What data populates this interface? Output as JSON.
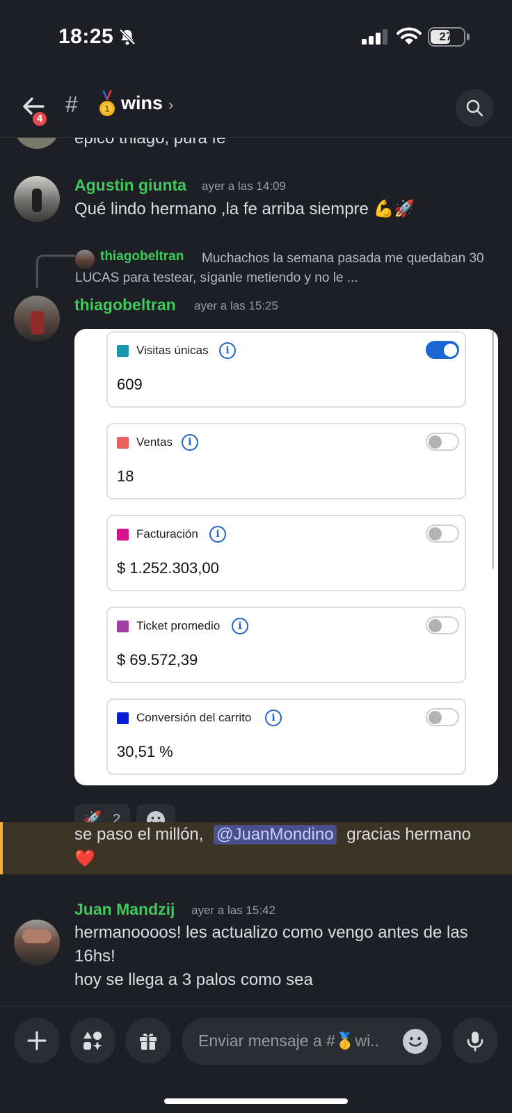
{
  "status_bar": {
    "time": "18:25",
    "battery": "27"
  },
  "header": {
    "back_badge": "4",
    "hash": "#",
    "channel_name": "wins",
    "chevron": "›"
  },
  "messages": [
    {
      "text": "epico thiago, pura fe"
    },
    {
      "username": "Agustin giunta",
      "timestamp": "ayer a las 14:09",
      "text": "Qué lindo hermano ,la fe arriba siempre 💪🚀"
    },
    {
      "reply": {
        "username": "thiagobeltran",
        "text": "Muchachos la semana pasada me quedaban 30 LUCAS para testear, síganle metiendo y no le ..."
      },
      "username": "thiagobeltran",
      "timestamp": "ayer a las 15:25",
      "image": {
        "metrics": [
          {
            "label": "Visitas únicas",
            "value": "609",
            "color": "#1a97b0",
            "toggle_on": true
          },
          {
            "label": "Ventas",
            "value": "18",
            "color": "#ee6060",
            "toggle_on": false
          },
          {
            "label": "Facturación",
            "value": "$ 1.252.303,00",
            "color": "#d4138d",
            "toggle_on": false
          },
          {
            "label": "Ticket promedio",
            "value": "$ 69.572,39",
            "color": "#a23ea6",
            "toggle_on": false
          },
          {
            "label": "Conversión del carrito",
            "value": "30,51 %",
            "color": "#0b1ed6",
            "toggle_on": false
          }
        ],
        "info_glyph": "i"
      },
      "reactions": [
        {
          "emoji": "🚀",
          "count": "2"
        }
      ]
    },
    {
      "text_before": "se paso el millón,",
      "mention": "@JuanMondino",
      "text_after": "gracias hermano",
      "emoji": "❤️"
    },
    {
      "username": "Juan Mandzij",
      "timestamp": "ayer a las 15:42",
      "lines": [
        "hermanoooos! les actualizo como vengo antes de las",
        "16hs!",
        "hoy se llega a 3 palos como sea"
      ]
    }
  ],
  "composer": {
    "placeholder": "Enviar mensaje a #🥇wi.."
  }
}
